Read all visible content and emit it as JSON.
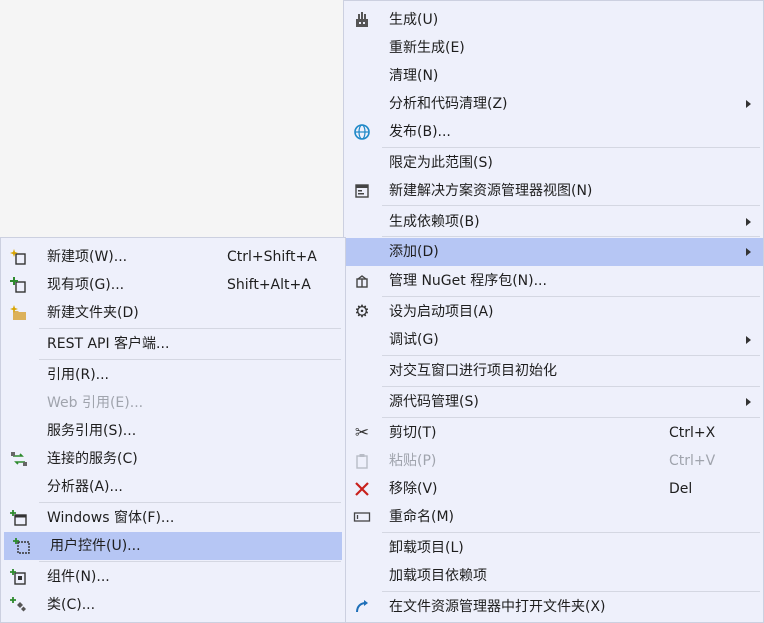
{
  "main_menu": {
    "items": [
      {
        "label": "生成(U)",
        "shortcut": "",
        "icon": "build-icon",
        "submenu": false,
        "disabled": false
      },
      {
        "label": "重新生成(E)",
        "shortcut": "",
        "icon": "",
        "submenu": false,
        "disabled": false
      },
      {
        "label": "清理(N)",
        "shortcut": "",
        "icon": "",
        "submenu": false,
        "disabled": false
      },
      {
        "label": "分析和代码清理(Z)",
        "shortcut": "",
        "icon": "",
        "submenu": true,
        "disabled": false
      },
      {
        "label": "发布(B)...",
        "shortcut": "",
        "icon": "publish-globe-icon",
        "submenu": false,
        "disabled": false
      },
      {
        "label": "限定为此范围(S)",
        "shortcut": "",
        "icon": "",
        "submenu": false,
        "disabled": false
      },
      {
        "label": "新建解决方案资源管理器视图(N)",
        "shortcut": "",
        "icon": "new-view-icon",
        "submenu": false,
        "disabled": false
      },
      {
        "label": "生成依赖项(B)",
        "shortcut": "",
        "icon": "",
        "submenu": true,
        "disabled": false
      },
      {
        "label": "添加(D)",
        "shortcut": "",
        "icon": "",
        "submenu": true,
        "disabled": false,
        "highlighted": true
      },
      {
        "label": "管理 NuGet 程序包(N)...",
        "shortcut": "",
        "icon": "nuget-package-icon",
        "submenu": false,
        "disabled": false
      },
      {
        "label": "设为启动项目(A)",
        "shortcut": "",
        "icon": "gear-icon",
        "submenu": false,
        "disabled": false
      },
      {
        "label": "调试(G)",
        "shortcut": "",
        "icon": "",
        "submenu": true,
        "disabled": false
      },
      {
        "label": "对交互窗口进行项目初始化",
        "shortcut": "",
        "icon": "",
        "submenu": false,
        "disabled": false
      },
      {
        "label": "源代码管理(S)",
        "shortcut": "",
        "icon": "",
        "submenu": true,
        "disabled": false
      },
      {
        "label": "剪切(T)",
        "shortcut": "Ctrl+X",
        "icon": "scissors-icon",
        "submenu": false,
        "disabled": false
      },
      {
        "label": "粘贴(P)",
        "shortcut": "Ctrl+V",
        "icon": "paste-icon",
        "submenu": false,
        "disabled": true
      },
      {
        "label": "移除(V)",
        "shortcut": "Del",
        "icon": "remove-x-icon",
        "submenu": false,
        "disabled": false
      },
      {
        "label": "重命名(M)",
        "shortcut": "",
        "icon": "rename-icon",
        "submenu": false,
        "disabled": false
      },
      {
        "label": "卸载项目(L)",
        "shortcut": "",
        "icon": "",
        "submenu": false,
        "disabled": false
      },
      {
        "label": "加载项目依赖项",
        "shortcut": "",
        "icon": "",
        "submenu": false,
        "disabled": false
      },
      {
        "label": "在文件资源管理器中打开文件夹(X)",
        "shortcut": "",
        "icon": "open-folder-arrow-icon",
        "submenu": false,
        "disabled": false
      }
    ]
  },
  "sub_menu": {
    "items": [
      {
        "label": "新建项(W)...",
        "shortcut": "Ctrl+Shift+A",
        "icon": "new-item-icon",
        "disabled": false
      },
      {
        "label": "现有项(G)...",
        "shortcut": "Shift+Alt+A",
        "icon": "existing-item-icon",
        "disabled": false
      },
      {
        "label": "新建文件夹(D)",
        "shortcut": "",
        "icon": "new-folder-icon",
        "disabled": false
      },
      {
        "label": "REST API 客户端...",
        "shortcut": "",
        "icon": "",
        "disabled": false
      },
      {
        "label": "引用(R)...",
        "shortcut": "",
        "icon": "",
        "disabled": false
      },
      {
        "label": "Web 引用(E)...",
        "shortcut": "",
        "icon": "",
        "disabled": true
      },
      {
        "label": "服务引用(S)...",
        "shortcut": "",
        "icon": "",
        "disabled": false
      },
      {
        "label": "连接的服务(C)",
        "shortcut": "",
        "icon": "connected-service-icon",
        "disabled": false
      },
      {
        "label": "分析器(A)...",
        "shortcut": "",
        "icon": "",
        "disabled": false
      },
      {
        "label": "Windows 窗体(F)...",
        "shortcut": "",
        "icon": "windows-form-icon",
        "disabled": false
      },
      {
        "label": "用户控件(U)...",
        "shortcut": "",
        "icon": "user-control-icon",
        "disabled": false,
        "highlighted": true
      },
      {
        "label": "组件(N)...",
        "shortcut": "",
        "icon": "component-icon",
        "disabled": false
      },
      {
        "label": "类(C)...",
        "shortcut": "",
        "icon": "class-icon",
        "disabled": false
      }
    ]
  }
}
